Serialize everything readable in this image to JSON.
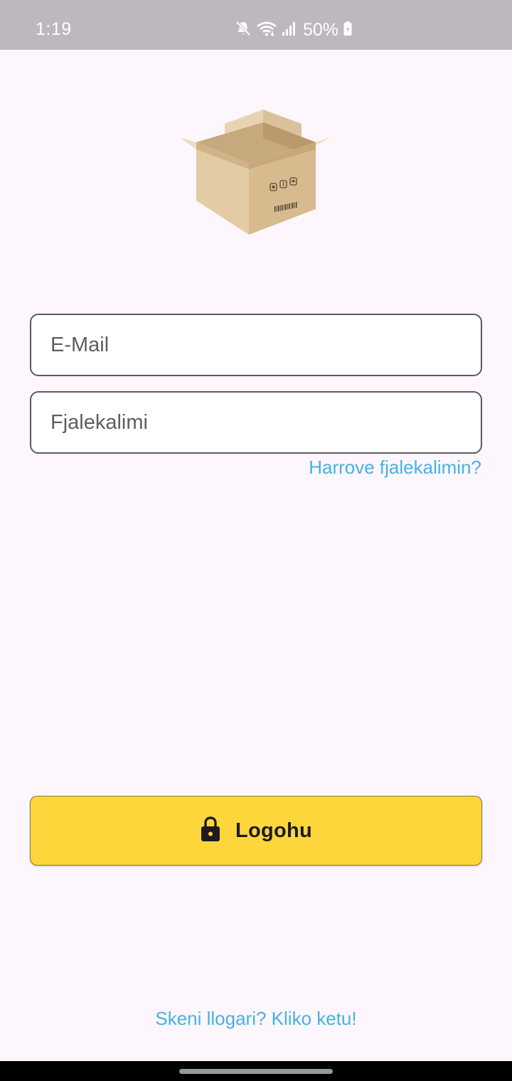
{
  "status_bar": {
    "time": "1:19",
    "battery": "50%",
    "icons": [
      "mute-icon",
      "wifi-icon",
      "signal-icon",
      "battery-icon"
    ]
  },
  "logo": {
    "icon": "cardboard-box-icon"
  },
  "form": {
    "email_placeholder": "E-Mail",
    "email_value": "",
    "password_placeholder": "Fjalekalimi",
    "password_value": "",
    "forgot_password": "Harrove fjalekalimin?"
  },
  "login_button": {
    "label": "Logohu",
    "icon": "lock-icon"
  },
  "signup_link": "Skeni llogari? Kliko ketu!",
  "colors": {
    "background": "#fdf6fc",
    "status_bar": "#bcb8bd",
    "accent_link": "#45b3e0",
    "button": "#fdd63c",
    "field_border": "#5b5960"
  }
}
